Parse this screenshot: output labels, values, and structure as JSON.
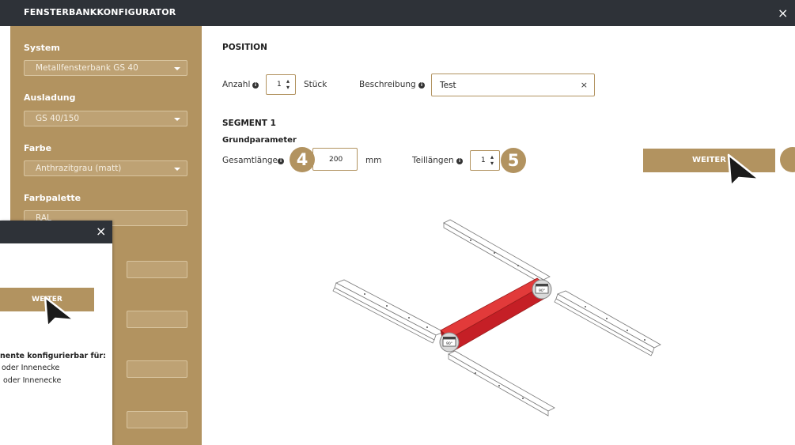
{
  "window": {
    "title": "FENSTERBANKKONFIGURATOR",
    "close_icon": "×"
  },
  "sidebar": {
    "system_label": "System",
    "system_value": "Metallfensterbank GS 40",
    "ausladung_label": "Ausladung",
    "ausladung_value": "GS 40/150",
    "farbe_label": "Farbe",
    "farbe_value": "Anthrazitgrau (matt)",
    "farbpalette_label": "Farbpalette",
    "farbpalette_value": "RAL"
  },
  "position": {
    "heading": "POSITION",
    "anzahl_label": "Anzahl",
    "anzahl_value": "1",
    "stueck_label": "Stück",
    "beschreibung_label": "Beschreibung",
    "beschreibung_value": "Test",
    "clear_icon": "×"
  },
  "segment": {
    "heading": "SEGMENT 1",
    "subheading": "Grundparameter",
    "gesamtlaenge_label": "Gesamtlänge",
    "gesamtlaenge_value": "200",
    "unit": "mm",
    "teillaengen_label": "Teillängen",
    "teillaengen_value": "1"
  },
  "steps": {
    "step4": "4",
    "step5": "5"
  },
  "buttons": {
    "weiter": "WEITER"
  },
  "popup": {
    "close_icon": "×",
    "weiter": "WEITER",
    "text_bold": "nente konfigurierbar für:",
    "text_line1": "oder Innenecke",
    "text_line2": "oder Innenecke"
  },
  "illustration": {
    "angle_left": "90°",
    "angle_right": "90°"
  },
  "colors": {
    "accent": "#b29360",
    "topbar": "#2e3238",
    "segment_red": "#d2232a"
  }
}
